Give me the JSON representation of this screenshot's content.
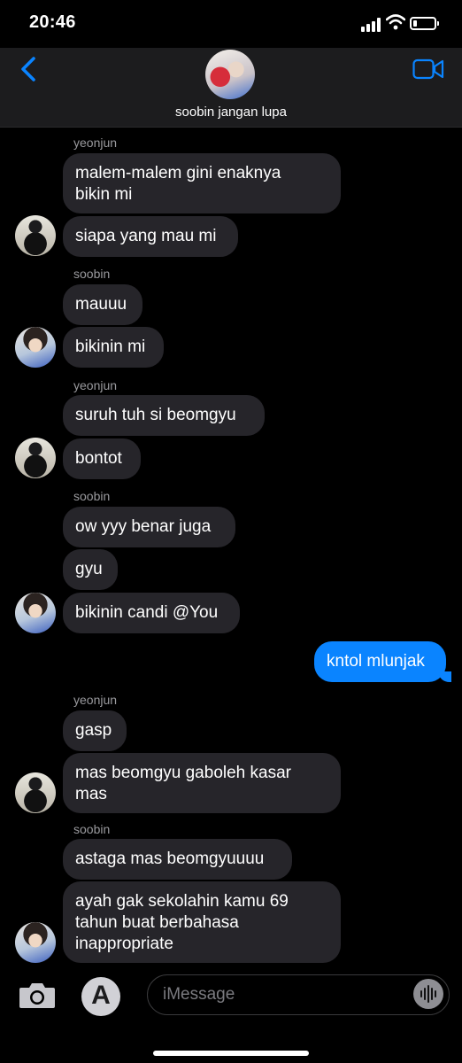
{
  "status_bar": {
    "time": "20:46",
    "battery_level": 0.2
  },
  "header": {
    "group_name": "soobin jangan lupa"
  },
  "messages": [
    {
      "sender": "yeonjun",
      "text": "malem-malem gini enaknya\nbikin mi"
    },
    {
      "text": "siapa yang mau mi"
    },
    {
      "sender": "soobin",
      "text": "mauuu"
    },
    {
      "text": "bikinin mi"
    },
    {
      "sender": "yeonjun",
      "text": "suruh tuh si beomgyu"
    },
    {
      "text": "bontot"
    },
    {
      "sender": "soobin",
      "text": "ow yyy benar juga"
    },
    {
      "text": "gyu"
    },
    {
      "text": "bikinin candi @You"
    },
    {
      "outgoing": true,
      "text": "kntol mlunjak"
    },
    {
      "sender": "yeonjun",
      "text": "gasp"
    },
    {
      "text": "mas beomgyu gaboleh kasar\nmas"
    },
    {
      "sender": "soobin",
      "text": "astaga mas beomgyuuuu"
    },
    {
      "text": "ayah gak sekolahin kamu 69\ntahun buat berbahasa\ninappropriate"
    }
  ],
  "composer": {
    "placeholder": "iMessage"
  },
  "colors": {
    "incoming_bubble": "#26252a",
    "outgoing_bubble": "#0a84ff",
    "accent": "#0a84ff"
  }
}
